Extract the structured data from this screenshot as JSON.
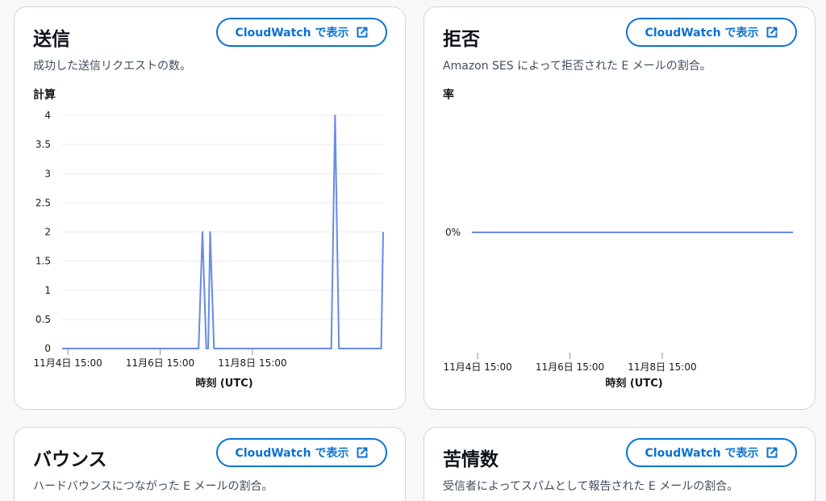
{
  "button_label": "CloudWatch で表示",
  "cards": {
    "sends": {
      "title": "送信",
      "description": "成功した送信リクエストの数。",
      "metric_label": "計算"
    },
    "rejects": {
      "title": "拒否",
      "description": "Amazon SES によって拒否された E メールの割合。",
      "metric_label": "率"
    },
    "bounces": {
      "title": "バウンス",
      "description": "ハードバウンスにつながった E メールの割合。"
    },
    "complaints": {
      "title": "苦情数",
      "description": "受信者によってスパムとして報告された E メールの割合。"
    }
  },
  "colors": {
    "accent": "#0972d3",
    "series": "#688ae8",
    "grid": "#e9ebed"
  },
  "chart_data": [
    {
      "type": "line",
      "xlabel": "時刻 (UTC)",
      "ylabel": "計算",
      "x_ticks": [
        "11月4日 15:00",
        "11月6日 15:00",
        "11月8日 15:00"
      ],
      "y_ticks": [
        "0",
        "0.5",
        "1",
        "1.5",
        "2",
        "2.5",
        "3",
        "3.5",
        "4"
      ],
      "ylim": [
        0,
        4
      ],
      "grid": true,
      "x_hours_range": [
        -3,
        164
      ],
      "x_tick_hours": [
        0,
        48,
        96
      ],
      "points": [
        {
          "h": -3,
          "y": 0
        },
        {
          "h": 68,
          "y": 0
        },
        {
          "h": 70,
          "y": 2
        },
        {
          "h": 72,
          "y": 0
        },
        {
          "h": 73,
          "y": 0
        },
        {
          "h": 74,
          "y": 2
        },
        {
          "h": 76,
          "y": 0
        },
        {
          "h": 137,
          "y": 0
        },
        {
          "h": 139,
          "y": 4
        },
        {
          "h": 141,
          "y": 0
        },
        {
          "h": 163,
          "y": 0
        },
        {
          "h": 164,
          "y": 2
        }
      ]
    },
    {
      "type": "line",
      "xlabel": "時刻 (UTC)",
      "ylabel": "率",
      "x_ticks": [
        "11月4日 15:00",
        "11月6日 15:00",
        "11月8日 15:00"
      ],
      "y_ticks": [
        "0%"
      ],
      "grid": false,
      "x_hours_range": [
        -3,
        164
      ],
      "x_tick_hours": [
        0,
        48,
        96
      ],
      "points": [
        {
          "h": -3,
          "y": 0
        },
        {
          "h": 164,
          "y": 0
        }
      ]
    }
  ]
}
